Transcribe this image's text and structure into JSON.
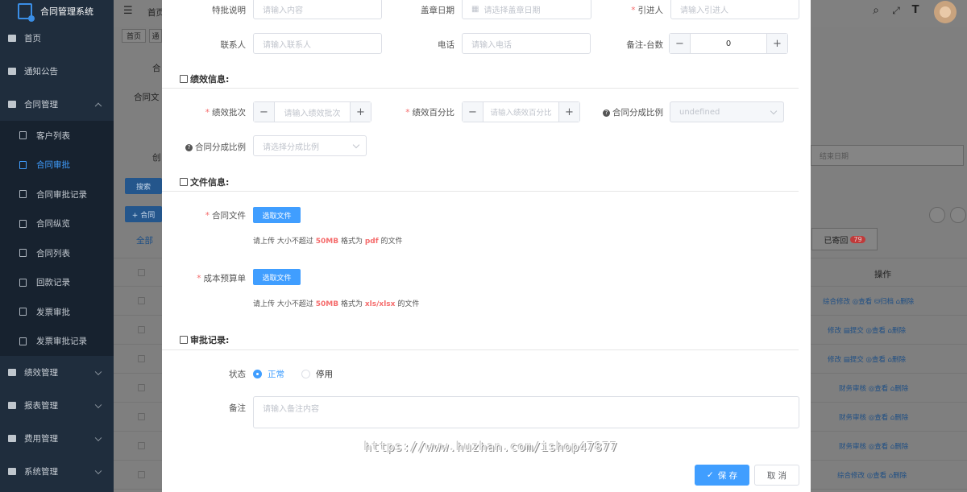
{
  "app": {
    "title": "合同管理系统"
  },
  "sidebar": {
    "items": [
      {
        "label": "首页",
        "icon": "dashboard-icon"
      },
      {
        "label": "通知公告",
        "icon": "message-icon"
      },
      {
        "label": "合同管理",
        "icon": "doc-icon",
        "expanded": true,
        "children": [
          "客户列表",
          "合同审批",
          "合同审批记录",
          "合同纵览",
          "合同列表",
          "回款记录",
          "发票审批",
          "发票审批记录"
        ],
        "active_child": "合同审批"
      },
      {
        "label": "绩效管理",
        "icon": "doc-icon"
      },
      {
        "label": "报表管理",
        "icon": "doc-icon"
      },
      {
        "label": "费用管理",
        "icon": "doc-icon"
      },
      {
        "label": "系统管理",
        "icon": "gear-icon"
      }
    ]
  },
  "background": {
    "breadcrumb": "首页",
    "tags": [
      "首页",
      "通"
    ],
    "labels": [
      "合",
      "合同文",
      "创"
    ],
    "search_btn": "搜索",
    "add_btn": "+ 合同",
    "date_end_placeholder": "结束日期",
    "tab_all": "全部",
    "tab_all_badge": "",
    "tab_returned": "已寄回",
    "tab_returned_badge": "79",
    "col_ops": "操作",
    "rows": [
      [
        "综合修改",
        "查看",
        "归档",
        "删除"
      ],
      [
        "修改",
        "提交",
        "查看",
        "删除"
      ],
      [
        "修改",
        "提交",
        "查看",
        "删除"
      ],
      [
        "财务审核",
        "查看",
        "删除"
      ],
      [
        "财务审核",
        "查看",
        "删除"
      ],
      [
        "财务审核",
        "查看",
        "删除"
      ],
      [
        "综合修改",
        "查看",
        "删除"
      ]
    ]
  },
  "form": {
    "r1": {
      "special_label": "特批说明",
      "special_ph": "请输入内容",
      "stamp_label": "盖章日期",
      "stamp_ph": "请选择盖章日期",
      "intro_label": "引进人",
      "intro_ph": "请输入引进人"
    },
    "r2": {
      "contact_label": "联系人",
      "contact_ph": "请输入联系人",
      "phone_label": "电话",
      "phone_ph": "请输入电话",
      "units_label": "备注-台数",
      "units_value": "0"
    },
    "perf": {
      "title": "绩效信息:",
      "batch_label": "绩效批次",
      "batch_ph": "请输入绩效批次",
      "pct_label": "绩效百分比",
      "pct_ph": "请输入绩效百分比",
      "ratio_label": "合同分成比例",
      "ratio_value": "undefined",
      "ratio2_label": "合同分成比例",
      "ratio2_ph": "请选择分成比例"
    },
    "file": {
      "title": "文件信息:",
      "contract_label": "合同文件",
      "contract_btn": "选取文件",
      "contract_tip_pre": "请上传 大小不超过",
      "contract_size": "50MB",
      "contract_tip_mid": "格式为",
      "contract_fmt": "pdf",
      "contract_tip_post": "的文件",
      "budget_label": "成本预算单",
      "budget_btn": "选取文件",
      "budget_tip_pre": "请上传 大小不超过",
      "budget_size": "50MB",
      "budget_tip_mid": "格式为",
      "budget_fmt": "xls/xlsx",
      "budget_tip_post": "的文件"
    },
    "approval": {
      "title": "审批记录:",
      "status_label": "状态",
      "opt_normal": "正常",
      "opt_disabled": "停用",
      "remark_label": "备注",
      "remark_ph": "请输入备注内容"
    },
    "footer": {
      "save": "保 存",
      "cancel": "取 消"
    }
  },
  "watermark": "https://www.huzhan.com/ishop47877",
  "colors": {
    "primary": "#409eff",
    "danger": "#f56c6c",
    "sidebar": "#1f2d3d"
  }
}
